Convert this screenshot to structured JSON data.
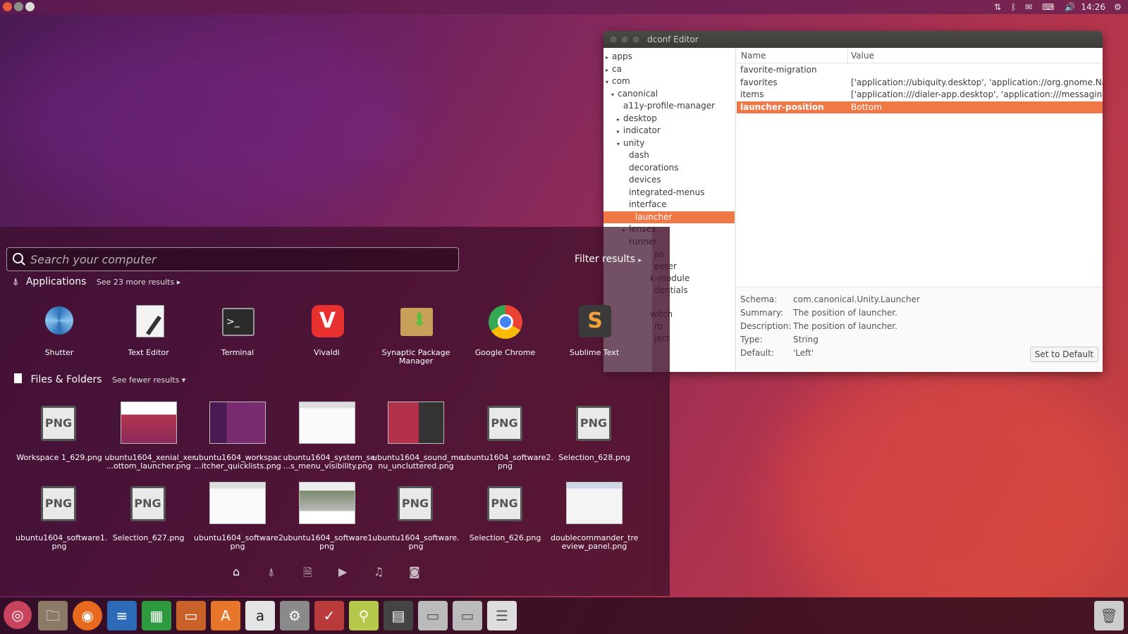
{
  "topbar": {
    "time": "14:26"
  },
  "dconf": {
    "title": "dconf Editor",
    "tree": [
      {
        "label": "apps",
        "arrow": "▸"
      },
      {
        "label": "ca",
        "arrow": "▸"
      },
      {
        "label": "com",
        "arrow": "▾"
      },
      {
        "label": "canonical",
        "arrow": "▾"
      },
      {
        "label": "a11y-profile-manager",
        "arrow": ""
      },
      {
        "label": "desktop",
        "arrow": "▸"
      },
      {
        "label": "indicator",
        "arrow": "▸"
      },
      {
        "label": "unity",
        "arrow": "▾"
      },
      {
        "label": "dash",
        "arrow": ""
      },
      {
        "label": "decorations",
        "arrow": ""
      },
      {
        "label": "devices",
        "arrow": ""
      },
      {
        "label": "integrated-menus",
        "arrow": ""
      },
      {
        "label": "interface",
        "arrow": ""
      },
      {
        "label": "launcher",
        "arrow": ""
      },
      {
        "label": "lenses",
        "arrow": "▸"
      },
      {
        "label": "runner",
        "arrow": ""
      }
    ],
    "tree_partial": [
      "ps",
      "eeter",
      "k-module",
      "dentials",
      "witch",
      "ro",
      "ject"
    ],
    "col_name": "Name",
    "col_value": "Value",
    "keys": [
      {
        "name": "favorite-migration",
        "value": ""
      },
      {
        "name": "favorites",
        "value": "['application://ubiquity.desktop', 'application://org.gnome.Na"
      },
      {
        "name": "items",
        "value": "['application:///dialer-app.desktop', 'application:///messaging"
      },
      {
        "name": "launcher-position",
        "value": "Bottom"
      }
    ],
    "info": {
      "schema_label": "Schema:",
      "schema": "com.canonical.Unity.Launcher",
      "summary_label": "Summary:",
      "summary": "The position of launcher.",
      "description_label": "Description:",
      "description": "The position of launcher.",
      "type_label": "Type:",
      "type": "String",
      "default_label": "Default:",
      "default": "'Left'"
    },
    "set_default": "Set to Default"
  },
  "dash": {
    "search_placeholder": "Search your computer",
    "filter": "Filter results",
    "applications": {
      "title": "Applications",
      "more": "See 23 more results"
    },
    "apps": [
      {
        "l1": "Shutter",
        "l2": ""
      },
      {
        "l1": "Text Editor",
        "l2": ""
      },
      {
        "l1": "Terminal",
        "l2": ""
      },
      {
        "l1": "Vivaldi",
        "l2": ""
      },
      {
        "l1": "Synaptic Package",
        "l2": "Manager"
      },
      {
        "l1": "Google Chrome",
        "l2": ""
      },
      {
        "l1": "Sublime Text",
        "l2": ""
      }
    ],
    "files": {
      "title": "Files & Folders",
      "more": "See fewer results"
    },
    "files_row1": [
      {
        "l1": "Workspace 1_629.png",
        "l2": ""
      },
      {
        "l1": "ubuntu1604_xenial_xer",
        "l2": "...ottom_launcher.png"
      },
      {
        "l1": "ubuntu1604_workspac",
        "l2": "...itcher_quicklists.png"
      },
      {
        "l1": "ubuntu1604_system_se",
        "l2": "...s_menu_visibility.png"
      },
      {
        "l1": "ubuntu1604_sound_me",
        "l2": "nu_uncluttered.png"
      },
      {
        "l1": "ubuntu1604_software2.",
        "l2": "png"
      },
      {
        "l1": "Selection_628.png",
        "l2": ""
      }
    ],
    "files_row2": [
      {
        "l1": "ubuntu1604_software1.",
        "l2": "png"
      },
      {
        "l1": "Selection_627.png",
        "l2": ""
      },
      {
        "l1": "ubuntu1604_software2.",
        "l2": "png"
      },
      {
        "l1": "ubuntu1604_software1.",
        "l2": "png"
      },
      {
        "l1": "ubuntu1604_software.",
        "l2": "png"
      },
      {
        "l1": "Selection_626.png",
        "l2": ""
      },
      {
        "l1": "doublecommander_tre",
        "l2": "eview_panel.png"
      }
    ],
    "png_label": "PNG"
  },
  "launcher": {
    "items": [
      "ubuntu-dash-icon",
      "files-icon",
      "firefox-icon",
      "writer-icon",
      "calc-icon",
      "impress-icon",
      "software-center-icon",
      "amazon-icon",
      "system-settings-icon",
      "search-tool-icon",
      "search-tool2-icon",
      "workspace-icon",
      "drive1-icon",
      "drive2-icon",
      "storage-icon",
      "trash-icon"
    ]
  }
}
